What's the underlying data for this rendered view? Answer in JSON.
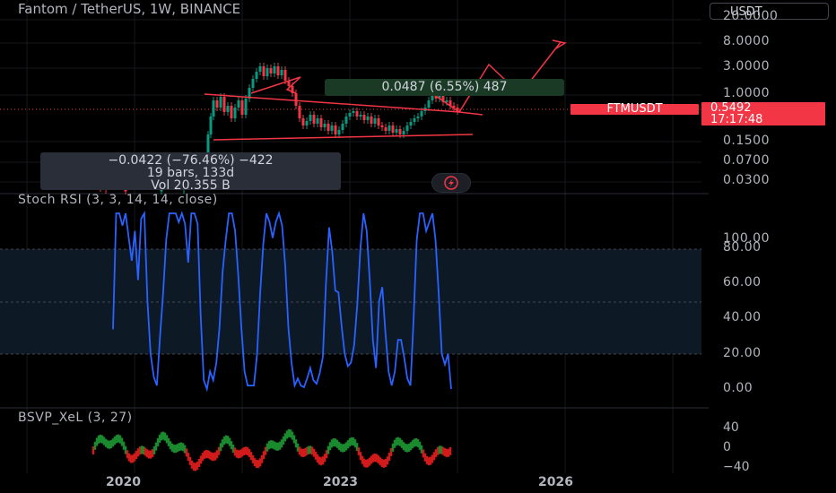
{
  "header": {
    "title": "Fantom / TetherUS, 1W, BINANCE",
    "currency": "USDT"
  },
  "price_axis": {
    "ticks": [
      "20.0000",
      "8.0000",
      "3.0000",
      "1.0000",
      "0.1500",
      "0.0700",
      "0.0300"
    ]
  },
  "symbol_badge": {
    "symbol": "FTMUSDT",
    "price": "0.5492",
    "countdown": "17:17:48"
  },
  "measure_tool": {
    "line1": "−0.0422 (−76.46%) −422",
    "line2": "19 bars, 133d",
    "line3": "Vol 20.355 B"
  },
  "range_label": {
    "text": "0.0487 (6.55%) 487"
  },
  "stoch_rsi": {
    "label": "Stoch RSI (3, 3, 14, 14, close)",
    "ticks": [
      "100.00",
      "80.00",
      "60.00",
      "40.00",
      "20.00",
      "0.00"
    ]
  },
  "bsvp": {
    "label": "BSVP_XeL (3, 27)",
    "ticks": [
      "40",
      "0",
      "−40"
    ]
  },
  "time_axis": {
    "ticks": [
      "2020",
      "2023",
      "2026"
    ]
  },
  "colors": {
    "background": "#000000",
    "stoch_line": "#2962ff",
    "band_fill": "#0d1a26",
    "bear": "#f23645",
    "bull": "#089981",
    "drawing": "#f23645",
    "bsvp_green": "#1b8a2e",
    "bsvp_red": "#d11a1a"
  },
  "chart_data": {
    "type": "line",
    "series": [
      {
        "values": [
          0.34,
          1,
          1,
          0.93,
          1,
          0.86,
          0.73,
          0.9,
          0.62,
          0.97,
          1,
          0.5,
          0.2,
          0.07,
          0.02,
          0.3,
          0.55,
          0.85,
          1,
          1,
          1,
          0.95,
          1,
          0.94,
          0.72,
          1,
          1,
          0.94,
          0.42,
          0.05,
          0,
          0.1,
          0.05,
          0.15,
          0.35,
          0.67,
          0.85,
          1,
          1,
          0.9,
          0.65,
          0.35,
          0.1,
          0.02,
          0.02,
          0.02,
          0.2,
          0.55,
          0.83,
          1,
          0.95,
          0.86,
          0.95,
          1,
          0.93,
          0.7,
          0.35,
          0.15,
          0.02,
          0.06,
          0.02,
          0.01,
          0.06,
          0.12,
          0.05,
          0.03,
          0.09,
          0.18,
          0.6,
          0.92,
          0.78,
          0.56,
          0.55,
          0.36,
          0.2,
          0.13,
          0.15,
          0.25,
          0.48,
          0.8,
          1,
          0.9,
          0.62,
          0.28,
          0.12,
          0.5,
          0.58,
          0.32,
          0.1,
          0.02,
          0.1,
          0.28,
          0.28,
          0.18,
          0.06,
          0.02,
          0.4,
          0.85,
          1,
          1,
          0.9,
          0.95,
          1,
          0.85,
          0.55,
          0.2,
          0.14,
          0.2,
          0
        ]
      }
    ],
    "ylim": [
      0,
      100
    ]
  }
}
